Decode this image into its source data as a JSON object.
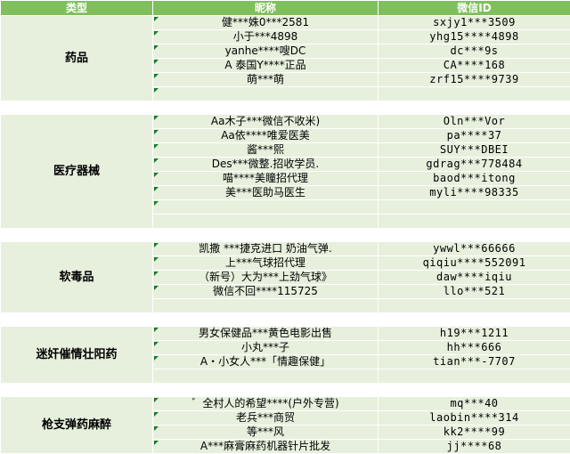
{
  "headers": [
    "类型",
    "昵称",
    "微信ID"
  ],
  "groups": [
    {
      "category": "药品",
      "rows": [
        {
          "nick": "健***姝0***2581",
          "wx": "sxjy1***3509"
        },
        {
          "nick": "小于***4898",
          "wx": "yhg15****4898"
        },
        {
          "nick": "yanhe****嗖DC",
          "wx": "dc***9s"
        },
        {
          "nick": "A  泰国Y****正品",
          "wx": "CA****168"
        },
        {
          "nick": "萌***萌",
          "wx": "zrf15****9739"
        }
      ]
    },
    {
      "category": "医疗器械",
      "rows": [
        {
          "nick": "Aa木子***微信不收米)",
          "wx": "Oln***Vor"
        },
        {
          "nick": "Aa依****唯爱医美",
          "wx": "pa****37"
        },
        {
          "nick": "酱***熙",
          "wx": "SUY***DBEI"
        },
        {
          "nick": "Des***微整.招收学员.",
          "wx": "gdrag***778484"
        },
        {
          "nick": "喵****美瞳招代理",
          "wx": "baod***itong"
        },
        {
          "nick": "美***医助马医生",
          "wx": "myli****98335"
        }
      ]
    },
    {
      "category": "软毒品",
      "rows": [
        {
          "nick": "凯撒  ***捷克进口  奶油气弹.",
          "wx": "ywwl***66666"
        },
        {
          "nick": "上***气球招代理",
          "wx": "qiqiu****552091"
        },
        {
          "nick": "（新号）大为***上劲气球》",
          "wx": "daw****iqiu"
        },
        {
          "nick": "微信不回****115725",
          "wx": "llo***521"
        }
      ]
    },
    {
      "category": "迷奸催情壮阳药",
      "rows": [
        {
          "nick": "男女保健品***黄色电影出售",
          "wx": "h19***1211"
        },
        {
          "nick": "小丸***子",
          "wx": "hh***666"
        },
        {
          "nick": "A・小女人***「情趣保健」",
          "wx": "tian***-7707"
        }
      ]
    },
    {
      "category": "枪支弹药麻醉",
      "rows": [
        {
          "nick": "゛全村人的希望****(户外专营)",
          "wx": "mq***40"
        },
        {
          "nick": "老兵***商贸",
          "wx": "laobin****314"
        },
        {
          "nick": "等***风",
          "wx": "kk2****99"
        },
        {
          "nick": "A***麻膏麻药机器针片批发",
          "wx": "jj****68"
        }
      ]
    }
  ]
}
